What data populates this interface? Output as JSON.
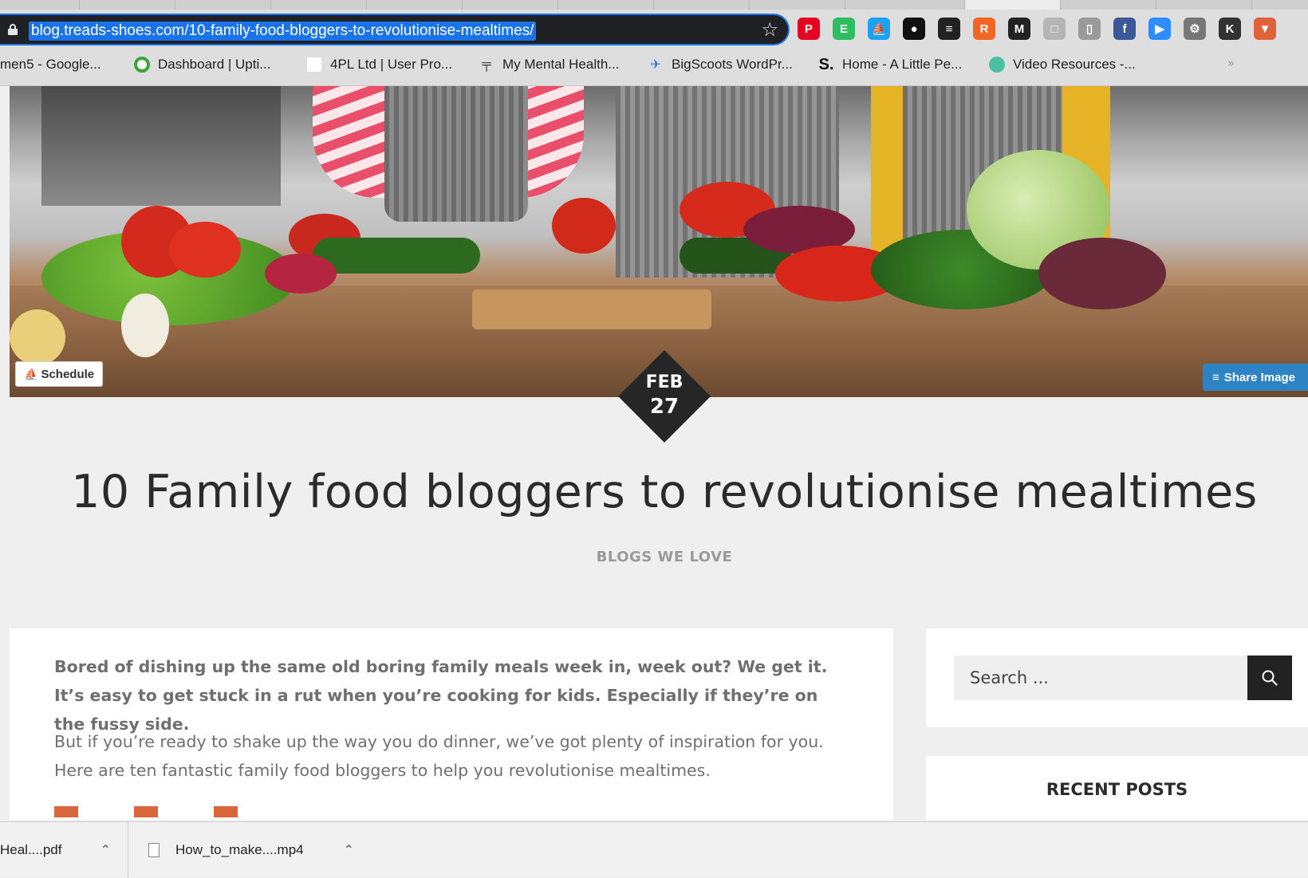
{
  "browser": {
    "url": "blog.treads-shoes.com/10-family-food-bloggers-to-revolutionise-mealtimes/",
    "bookmarks": [
      {
        "label": "men5 - Google...",
        "color": "#ffffff"
      },
      {
        "label": "Dashboard | Upti...",
        "color": "#3aa53a"
      },
      {
        "label": "4PL Ltd | User Pro...",
        "color": "#ffffff"
      },
      {
        "label": "My Mental Health...",
        "color": "#333333"
      },
      {
        "label": "BigScoots WordPr...",
        "color": "#3b6fd8"
      },
      {
        "label": "Home - A Little Pe...",
        "color": "#111111"
      },
      {
        "label": "Video Resources -...",
        "color": "#4bbfa5"
      }
    ],
    "bookmark_icons": [
      "document-icon",
      "uptime-icon",
      "page-icon",
      "mental-health-icon",
      "bigscoots-icon",
      "s-logo-icon",
      "video-icon"
    ],
    "extensions": [
      {
        "name": "pinterest-icon",
        "glyph": "P",
        "color": "#e60023"
      },
      {
        "name": "evernote-icon",
        "glyph": "E",
        "color": "#2dbe60"
      },
      {
        "name": "buffer-sail-icon",
        "glyph": "⛵",
        "color": "#1da1f2"
      },
      {
        "name": "hootsuite-owl-icon",
        "glyph": "●",
        "color": "#111111"
      },
      {
        "name": "buffer-stack-icon",
        "glyph": "≡",
        "color": "#222222"
      },
      {
        "name": "rss-icon",
        "glyph": "R",
        "color": "#f26522"
      },
      {
        "name": "medium-icon",
        "glyph": "M",
        "color": "#222222"
      },
      {
        "name": "chat-extension-icon",
        "glyph": "□",
        "color": "#b5b5b5"
      },
      {
        "name": "clipboard-icon",
        "glyph": "▯",
        "color": "#9a9a9a"
      },
      {
        "name": "facebook-icon",
        "glyph": "f",
        "color": "#3b5998"
      },
      {
        "name": "zoom-icon",
        "glyph": "▶",
        "color": "#2d8cff"
      },
      {
        "name": "gear-extension-icon",
        "glyph": "⚙",
        "color": "#777777"
      },
      {
        "name": "profile-k-icon",
        "glyph": "K",
        "color": "#333333"
      },
      {
        "name": "shield-icon",
        "glyph": "▼",
        "color": "#e0623a"
      }
    ]
  },
  "hero": {
    "schedule_label": "Schedule",
    "share_label": "Share Image"
  },
  "post": {
    "date_month": "FEB",
    "date_day": "27",
    "title": "10 Family food bloggers to revolutionise mealtimes",
    "category": "BLOGS WE LOVE",
    "lead": "Bored of dishing up the same old boring family meals week in, week out? We get it. It’s easy to get stuck in a rut when you’re cooking for kids. Especially if they’re on the fussy side.",
    "paragraph": "But if you’re ready to shake up the way you do dinner, we’ve got plenty of inspiration for you. Here are ten fantastic family food bloggers to help you revolutionise mealtimes."
  },
  "sidebar": {
    "search_placeholder": "Search ...",
    "recent_posts_title": "RECENT POSTS"
  },
  "downloads": [
    {
      "label": "Heal....pdf"
    },
    {
      "label": "How_to_make....mp4"
    }
  ]
}
